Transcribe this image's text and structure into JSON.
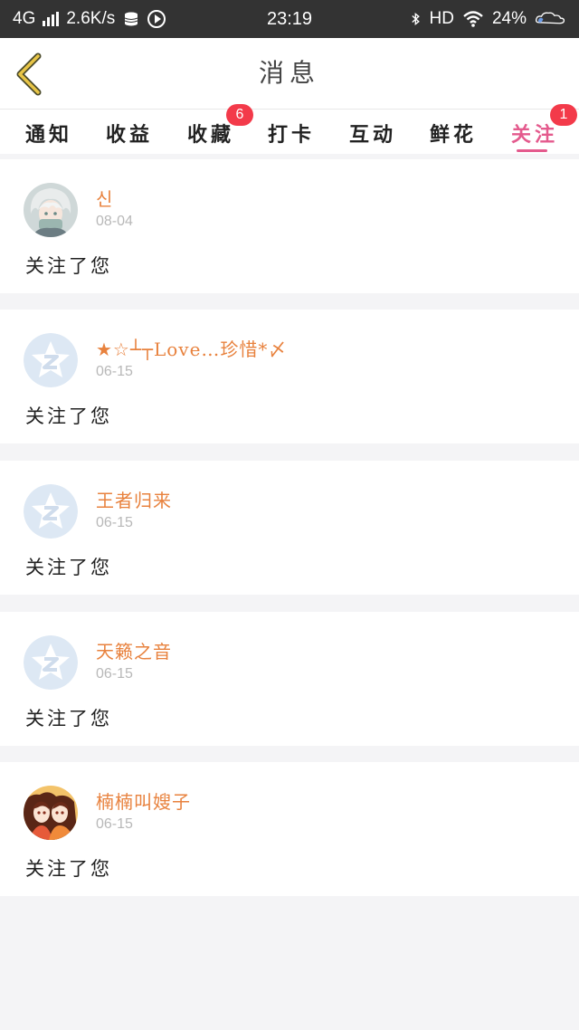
{
  "status_bar": {
    "network": "4G",
    "speed": "2.6K/s",
    "time": "23:19",
    "hd": "HD",
    "battery": "24%"
  },
  "header": {
    "title": "消息",
    "back_icon": "chevron-left-icon",
    "accent_color": "#e8c547"
  },
  "tabs": [
    {
      "label": "通知"
    },
    {
      "label": "收益"
    },
    {
      "label": "收藏",
      "badge": "6"
    },
    {
      "label": "打卡"
    },
    {
      "label": "互动"
    },
    {
      "label": "鲜花"
    },
    {
      "label": "关注",
      "badge": "1",
      "active": true
    }
  ],
  "messages": [
    {
      "name": "신",
      "date": "08-04",
      "text": "关注了您",
      "avatar": "anime-avatar-white-hair"
    },
    {
      "name": "★☆┴┬Love…珍惜*〆",
      "date": "06-15",
      "text": "关注了您",
      "avatar": "qq-default-avatar"
    },
    {
      "name": "王者归来",
      "date": "06-15",
      "text": "关注了您",
      "avatar": "qq-default-avatar"
    },
    {
      "name": "天籁之音",
      "date": "06-15",
      "text": "关注了您",
      "avatar": "qq-default-avatar"
    },
    {
      "name": "楠楠叫嫂子",
      "date": "06-15",
      "text": "关注了您",
      "avatar": "anime-avatar-two-girls"
    }
  ],
  "colors": {
    "active_tab": "#e45a8d",
    "badge": "#f33a4a",
    "username": "#e8823e",
    "date": "#b8b8b8"
  }
}
